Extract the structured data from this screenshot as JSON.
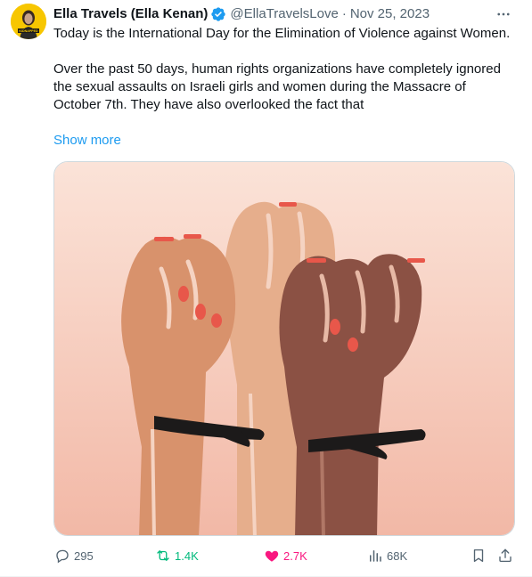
{
  "tweet": {
    "author": {
      "display_name": "Ella Travels (Ella Kenan)",
      "handle": "@EllaTravelsLove",
      "verified": true,
      "avatar_badge_text": "KIDNAPPED"
    },
    "separator": "·",
    "date": "Nov 25, 2023",
    "paragraphs": [
      "Today is the International Day for the Elimination of Violence against Women.",
      "Over the past 50 days, human rights organizations have completely ignored the sexual assaults on Israeli girls and women during the Massacre of October 7th. They have also overlooked the fact that"
    ],
    "show_more": "Show more",
    "media": {
      "description_icon": "raised-fists-illustration",
      "background": "#f7d5c8"
    },
    "actions": {
      "replies": "295",
      "retweets": "1.4K",
      "likes": "2.7K",
      "views": "68K"
    }
  },
  "colors": {
    "link": "#1d9bf0",
    "secondary_text": "#536471",
    "retweet_active": "#00ba7c",
    "like_active": "#f91880",
    "verified": "#1d9bf0"
  }
}
